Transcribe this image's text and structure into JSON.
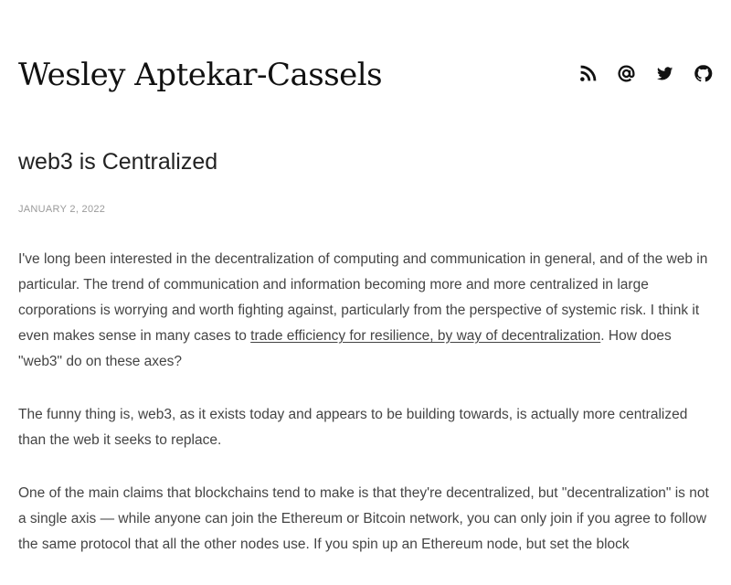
{
  "site": {
    "title": "Wesley Aptekar-Cassels",
    "social_links": [
      {
        "icon": "rss-icon",
        "label": "RSS"
      },
      {
        "icon": "email-icon",
        "label": "Email"
      },
      {
        "icon": "twitter-icon",
        "label": "Twitter"
      },
      {
        "icon": "github-icon",
        "label": "GitHub"
      }
    ]
  },
  "post": {
    "title": "web3 is Centralized",
    "date": "January 2, 2022",
    "p1": {
      "text_before": "I've long been interested in the decentralization of computing and communication in general, and of the web in particular. The trend of communication and information becoming more and more centralized in large corporations is worrying and worth fighting against, particularly from the perspective of systemic risk. I think it even makes sense in many cases to ",
      "link_text": "trade efficiency for resilience, by way of decentralization",
      "text_after": ". How does \"web3\" do on these axes?"
    },
    "p2": "The funny thing is, web3, as it exists today and appears to be building towards, is actually more centralized than the web it seeks to replace.",
    "p3": "One of the main claims that blockchains tend to make is that they're decentralized, but \"decentralization\" is not a single axis — while anyone can join the Ethereum or Bitcoin network, you can only join if you agree to follow the same protocol that all the other nodes use. If you spin up an Ethereum node, but set the block"
  }
}
